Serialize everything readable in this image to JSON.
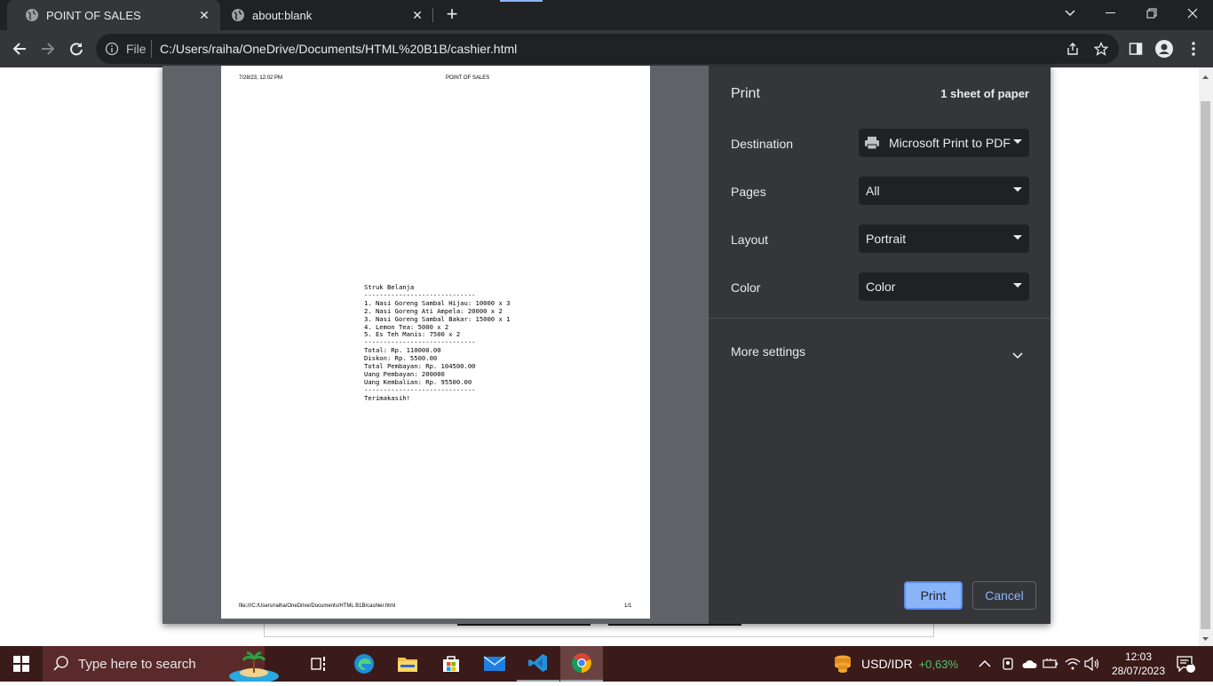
{
  "browser": {
    "tabs": [
      {
        "title": "POINT OF SALES",
        "active": true
      },
      {
        "title": "about:blank",
        "active": false
      }
    ],
    "omnibox": {
      "scheme_label": "File",
      "url": "C:/Users/raiha/OneDrive/Documents/HTML%20B1B/cashier.html"
    }
  },
  "preview": {
    "header_left": "7/28/23, 12:02 PM",
    "header_center": "POINT OF SALES",
    "footer_left": "file:///C:/Users/raiha/OneDrive/Documents/HTML B1B/cashier.html",
    "footer_right": "1/1",
    "receipt_lines": [
      "Struk Belanja",
      "-----------------------------",
      "1. Nasi Goreng Sambal Hijau: 10000 x 3",
      "2. Nasi Goreng Ati Ampela: 20000 x 2",
      "3. Nasi Goreng Sambal Bakar: 15000 x 1",
      "4. Lemon Tea: 5000 x 2",
      "5. Es Teh Manis: 7500 x 2",
      "-----------------------------",
      "Total: Rp. 110000.00",
      "Diskon: Rp. 5500.00",
      "Total Pembayan: Rp. 104500.00",
      "Uang Pembayan: 200000",
      "Uang Kembalian: Rp. 95500.00",
      "-----------------------------",
      "Terimakasih!"
    ]
  },
  "print_settings": {
    "title": "Print",
    "sheet_count": "1 sheet of paper",
    "destination_label": "Destination",
    "destination_value": "Microsoft Print to PDF",
    "pages_label": "Pages",
    "pages_value": "All",
    "layout_label": "Layout",
    "layout_value": "Portrait",
    "color_label": "Color",
    "color_value": "Color",
    "more_settings": "More settings",
    "print_button": "Print",
    "cancel_button": "Cancel"
  },
  "taskbar": {
    "search_placeholder": "Type here to search",
    "ticker_symbol": "USD/IDR",
    "ticker_change": "+0,63%",
    "time": "12:03",
    "date": "28/07/2023",
    "notification_count": "1"
  },
  "colors": {
    "accent_blue": "#8ab4f8",
    "ticker_green": "#4cc46a",
    "dialog_bg": "#35363a",
    "chrome_dark": "#202124"
  }
}
